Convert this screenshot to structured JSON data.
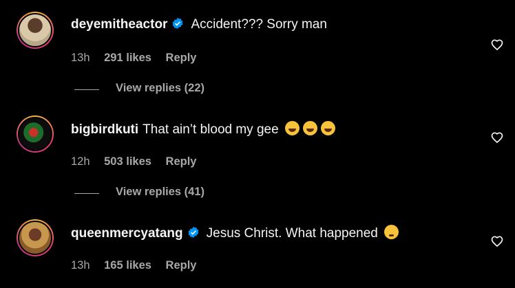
{
  "comments": [
    {
      "username": "deyemitheactor",
      "verified": true,
      "text": "Accident??? Sorry man",
      "emojis": [],
      "time": "13h",
      "likes": "291 likes",
      "reply_label": "Reply",
      "view_replies": "View replies (22)"
    },
    {
      "username": "bigbirdkuti",
      "verified": false,
      "text": "That ain’t blood my gee",
      "emojis": [
        "face-with-tears-of-joy",
        "face-with-tears-of-joy",
        "face-with-tears-of-joy"
      ],
      "time": "12h",
      "likes": "503 likes",
      "reply_label": "Reply",
      "view_replies": "View replies (41)"
    },
    {
      "username": "queenmercyatang",
      "verified": true,
      "text": "Jesus Christ. What happened",
      "emojis": [
        "flushed-face"
      ],
      "time": "13h",
      "likes": "165 likes",
      "reply_label": "Reply"
    }
  ],
  "colors": {
    "background": "#000000",
    "primary_text": "#f5f5f5",
    "secondary_text": "#a8a8a8",
    "verified_badge": "#0095f6"
  }
}
